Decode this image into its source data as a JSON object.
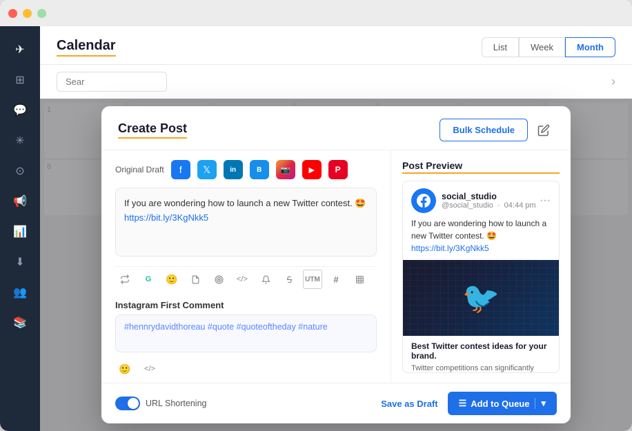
{
  "window": {
    "titlebar": {
      "dot_red": "close",
      "dot_yellow": "minimize",
      "dot_green": "maximize"
    }
  },
  "sidebar": {
    "items": [
      {
        "id": "compass",
        "icon": "🧭",
        "active": true
      },
      {
        "id": "grid",
        "icon": "⊞",
        "active": false
      },
      {
        "id": "chat",
        "icon": "💬",
        "active": false
      },
      {
        "id": "analytics",
        "icon": "✳",
        "active": false
      },
      {
        "id": "support",
        "icon": "⊙",
        "active": false
      },
      {
        "id": "megaphone",
        "icon": "📢",
        "active": false
      },
      {
        "id": "chart",
        "icon": "📊",
        "active": false
      },
      {
        "id": "download",
        "icon": "⬇",
        "active": false
      },
      {
        "id": "people",
        "icon": "👥",
        "active": false
      },
      {
        "id": "books",
        "icon": "📚",
        "active": false
      }
    ]
  },
  "calendar": {
    "title": "Calendar",
    "view_buttons": [
      {
        "label": "List",
        "active": false
      },
      {
        "label": "Week",
        "active": false
      },
      {
        "label": "Month",
        "active": true
      }
    ],
    "search_placeholder": "Sear",
    "chevron_right": "›"
  },
  "modal": {
    "title": "Create Post",
    "bulk_schedule_label": "Bulk Schedule",
    "edit_icon": "✎",
    "platform_tabs": {
      "original_draft_label": "Original Draft",
      "platforms": [
        {
          "id": "facebook",
          "label": "f",
          "class": "pi-facebook"
        },
        {
          "id": "twitter",
          "label": "𝕏",
          "class": "pi-twitter"
        },
        {
          "id": "linkedin",
          "label": "in",
          "class": "pi-linkedin"
        },
        {
          "id": "buffer",
          "label": "B",
          "class": "pi-buffer"
        },
        {
          "id": "instagram",
          "label": "📷",
          "class": "pi-instagram"
        },
        {
          "id": "youtube",
          "label": "▶",
          "class": "pi-youtube"
        },
        {
          "id": "pinterest",
          "label": "P",
          "class": "pi-pinterest"
        }
      ]
    },
    "compose": {
      "text": "If you are wondering how to launch a new Twitter contest. 🤩",
      "link": "https://bit.ly/3KgNkk5",
      "toolbar_icons": [
        {
          "id": "repost",
          "symbol": "⟳"
        },
        {
          "id": "grammarly",
          "symbol": "G"
        },
        {
          "id": "emoji",
          "symbol": "😊"
        },
        {
          "id": "file",
          "symbol": "📄"
        },
        {
          "id": "target",
          "symbol": "◎"
        },
        {
          "id": "code",
          "symbol": "</>"
        },
        {
          "id": "bell",
          "symbol": "🔔"
        },
        {
          "id": "strikethrough",
          "symbol": "S̶"
        },
        {
          "id": "utm",
          "symbol": "UTM"
        },
        {
          "id": "hashtag",
          "symbol": "#"
        },
        {
          "id": "table",
          "symbol": "⊞"
        }
      ]
    },
    "instagram_comment": {
      "label": "Instagram First Comment",
      "text": "#hennrydavidthoreau #quote #quoteoftheday #nature",
      "toolbar_icons": [
        {
          "id": "emoji",
          "symbol": "😊"
        },
        {
          "id": "code",
          "symbol": "</>"
        }
      ]
    },
    "footer": {
      "url_shortening_label": "URL Shortening",
      "url_shortening_active": true,
      "save_draft_label": "Save as Draft",
      "add_to_queue_label": "Add to Queue"
    }
  },
  "preview": {
    "title": "Post Preview",
    "username": "social_studio",
    "handle": "@social_studio",
    "time": "04:44 pm",
    "text": "If you are wondering how to launch a new Twitter contest. 🤩",
    "link": "https://bit.ly/3KgNkk5",
    "card_title": "Best Twitter contest ideas for your brand.",
    "card_desc": "Twitter competitions can significantly increase brand awareness and revenue for your company. Here are some great Twitter contest ideas you can use.",
    "more_icon": "•••"
  },
  "colors": {
    "accent_orange": "#f5a623",
    "brand_blue": "#1e6fe8",
    "sidebar_bg": "#1e2a3a"
  }
}
